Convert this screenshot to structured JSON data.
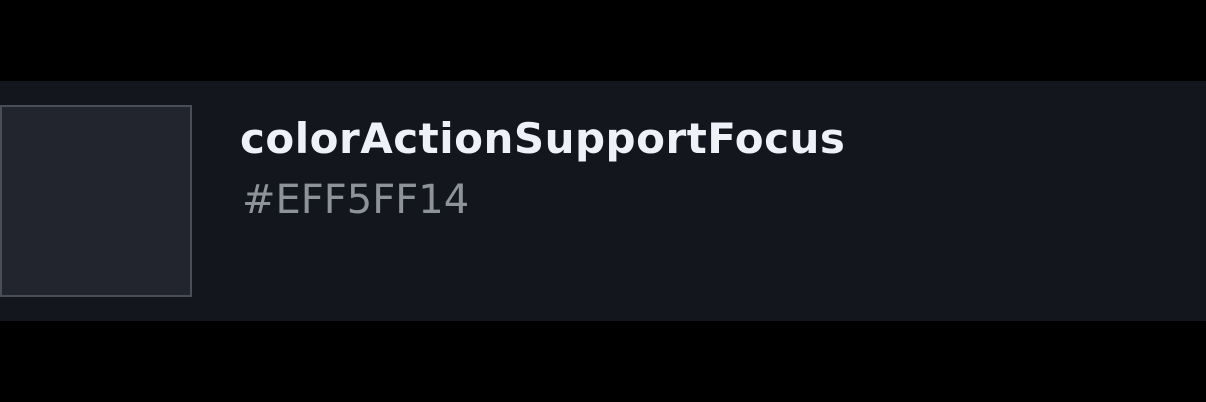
{
  "token": {
    "name": "colorActionSupportFocus",
    "value": "#EFF5FF14"
  },
  "colors": {
    "page_background": "#000000",
    "row_background": "#13161c",
    "swatch_fill": "#22252d",
    "swatch_border": "#4a4e56",
    "name_text": "#eef1f6",
    "value_text": "#8d929b"
  }
}
